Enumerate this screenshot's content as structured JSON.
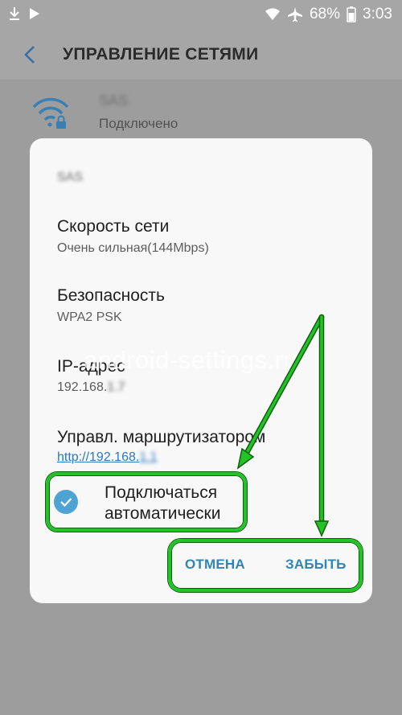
{
  "status_bar": {
    "battery": "68%",
    "time": "3:03"
  },
  "header": {
    "title": "УПРАВЛЕНИЕ СЕТЯМИ"
  },
  "network_item": {
    "name": "SAS",
    "status": "Подключено"
  },
  "dialog": {
    "title": "SAS",
    "speed": {
      "label": "Скорость сети",
      "value": "Очень сильная(144Mbps)"
    },
    "security": {
      "label": "Безопасность",
      "value": "WPA2 PSK"
    },
    "ip": {
      "label": "IP-адрес",
      "value": "192.168.",
      "hidden": "1.7"
    },
    "router": {
      "label": "Управл. маршрутизатором",
      "link": "http://192.168.",
      "hidden": "1.1"
    },
    "auto_connect": {
      "label_line1": "Подключаться",
      "label_line2": "автоматически",
      "checked": true
    },
    "cancel_label": "ОТМЕНА",
    "forget_label": "ЗАБЫТЬ"
  },
  "watermark": "android-settings.ru",
  "colors": {
    "accent": "#2f86b6",
    "check": "#4ca3d4",
    "highlight": "#22c326"
  }
}
